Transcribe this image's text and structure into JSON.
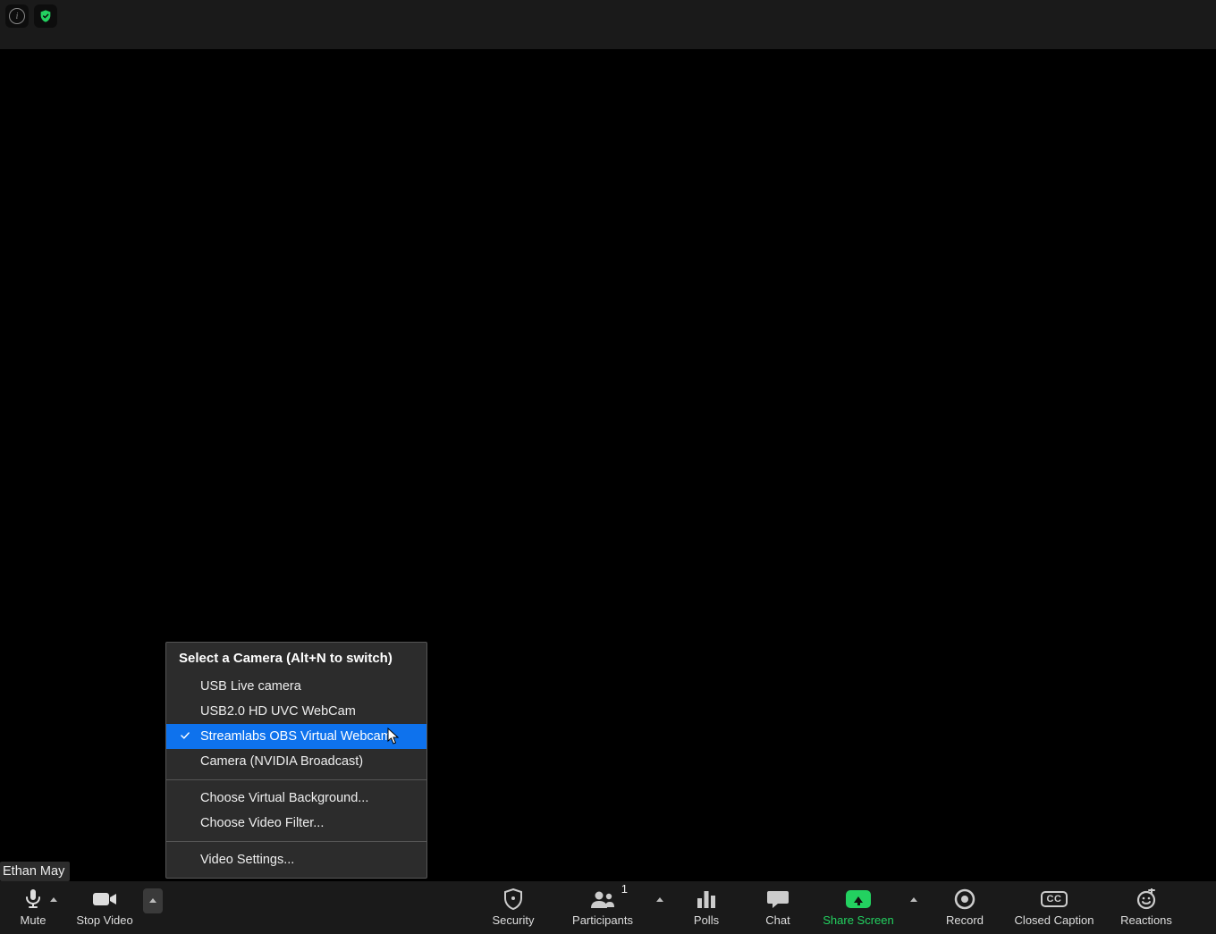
{
  "top": {
    "info_tooltip": "i",
    "encryption_ok": true
  },
  "participant_name": "Ethan May",
  "video_menu": {
    "title": "Select a Camera (Alt+N to switch)",
    "cameras": [
      {
        "label": "USB  Live camera",
        "selected": false
      },
      {
        "label": "USB2.0 HD UVC WebCam",
        "selected": false
      },
      {
        "label": "Streamlabs OBS Virtual Webcam",
        "selected": true
      },
      {
        "label": "Camera (NVIDIA Broadcast)",
        "selected": false
      }
    ],
    "extras": [
      "Choose Virtual Background...",
      "Choose Video Filter..."
    ],
    "settings": "Video Settings..."
  },
  "toolbar": {
    "mute": "Mute",
    "stop_video": "Stop Video",
    "security": "Security",
    "participants": "Participants",
    "participants_count": "1",
    "polls": "Polls",
    "chat": "Chat",
    "share_screen": "Share Screen",
    "record": "Record",
    "closed_caption": "Closed Caption",
    "cc_label": "CC",
    "reactions": "Reactions"
  }
}
